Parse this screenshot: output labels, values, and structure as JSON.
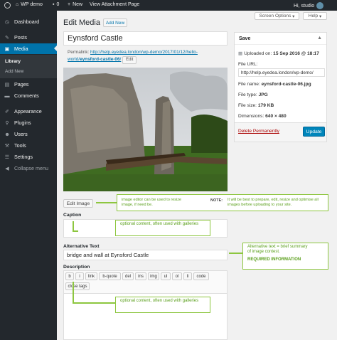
{
  "adminbar": {
    "site_name": "WP demo",
    "comments_count": "0",
    "new_label": "New",
    "view_attachment": "View Attachment Page",
    "greeting": "Hi, studio"
  },
  "menu": {
    "dashboard": "Dashboard",
    "posts": "Posts",
    "media": "Media",
    "library": "Library",
    "add_new": "Add New",
    "pages": "Pages",
    "comments": "Comments",
    "appearance": "Appearance",
    "plugins": "Plugins",
    "users": "Users",
    "tools": "Tools",
    "settings": "Settings",
    "collapse": "Collapse menu"
  },
  "screen_options": "Screen Options",
  "help": "Help",
  "heading": "Edit Media",
  "add_new_button": "Add New",
  "title_value": "Eynsford Castle",
  "permalink": {
    "label": "Permalink:",
    "url_start": "http://help.eyedea.london/wp-demo/2017/01/12/hello-world/",
    "slug": "eynsford-castle-06",
    "url_end": "/",
    "edit": "Edit"
  },
  "edit_image_button": "Edit Image",
  "notes": {
    "image_editor": "image editor can be used to resize image, if need be.",
    "note_label": "NOTE:",
    "note_text": "It will be best to prepare, edit, resize and optimise all images before uploading to your site.",
    "caption_optional": "optional content, often used with galleries",
    "alt_text": "Alternative text = brief summary of image contest.",
    "required": "REQUIRED INFORMATION",
    "desc_optional": "optional content, often used with galleries"
  },
  "caption_label": "Caption",
  "alt_label": "Alternative Text",
  "alt_value": "bridge and wall at Eynsford Castle",
  "description_label": "Description",
  "toolbar": [
    "b",
    "i",
    "link",
    "b-quote",
    "del",
    "ins",
    "img",
    "ul",
    "ol",
    "li",
    "code"
  ],
  "close_tags": "close tags",
  "save": {
    "title": "Save",
    "uploaded_on_label": "Uploaded on:",
    "uploaded_on": "15 Sep 2016 @ 18:17",
    "file_url_label": "File URL:",
    "file_url": "http://help.eyedea.london/wp-demo/",
    "file_name_label": "File name:",
    "file_name": "eynsford-castle-06.jpg",
    "file_type_label": "File type:",
    "file_type": "JPG",
    "file_size_label": "File size:",
    "file_size": "179 KB",
    "dimensions_label": "Dimensions:",
    "dimensions": "640 × 480",
    "delete": "Delete Permanently",
    "update": "Update"
  },
  "colors": {
    "admin_bar": "#23282d",
    "accent": "#0073aa",
    "note_green": "#8dc63f",
    "delete_red": "#a00"
  }
}
